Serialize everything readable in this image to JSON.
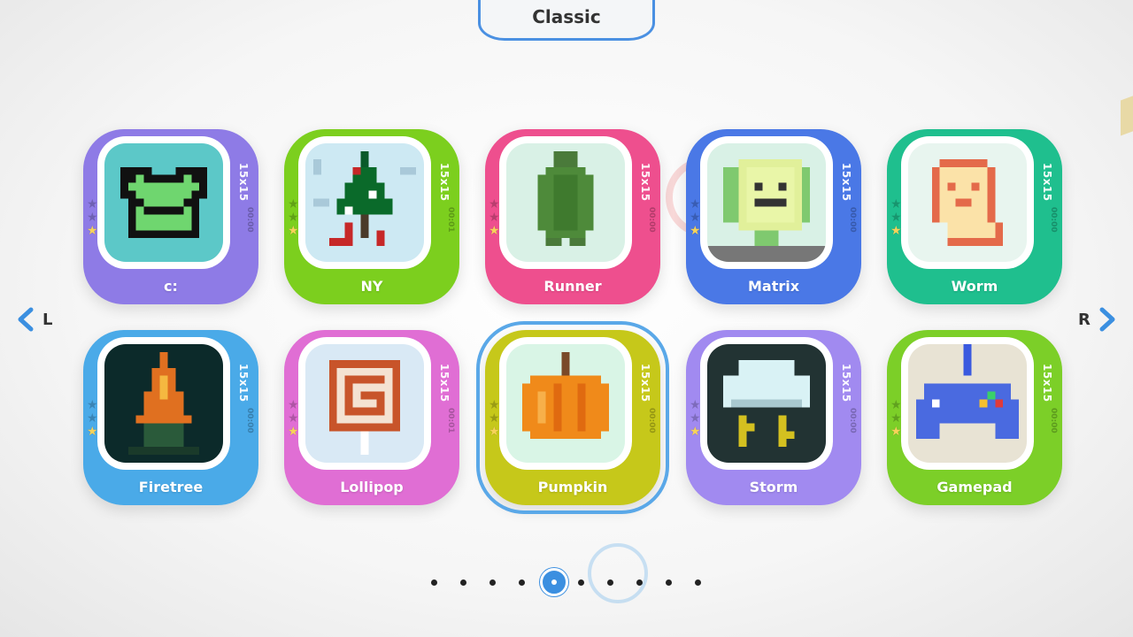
{
  "header": {
    "category": "Classic"
  },
  "nav": {
    "left_label": "L",
    "right_label": "R"
  },
  "puzzles": [
    {
      "title": "c:",
      "size": "15x15",
      "time": "00:00",
      "color": "#8e7be6",
      "stars": 1
    },
    {
      "title": "NY",
      "size": "15x15",
      "time": "00:01",
      "color": "#7ccf1e",
      "stars": 1
    },
    {
      "title": "Runner",
      "size": "15x15",
      "time": "00:00",
      "color": "#ee4f8e",
      "stars": 1
    },
    {
      "title": "Matrix",
      "size": "15x15",
      "time": "00:00",
      "color": "#4a78e6",
      "stars": 1
    },
    {
      "title": "Worm",
      "size": "15x15",
      "time": "00:00",
      "color": "#1fbf8e",
      "stars": 1
    },
    {
      "title": "Firetree",
      "size": "15x15",
      "time": "00:00",
      "color": "#4aaae8",
      "stars": 1
    },
    {
      "title": "Lollipop",
      "size": "15x15",
      "time": "00:01",
      "color": "#e06ed4",
      "stars": 1
    },
    {
      "title": "Pumpkin",
      "size": "15x15",
      "time": "00:00",
      "color": "#c6c81a",
      "stars": 1,
      "selected": true
    },
    {
      "title": "Storm",
      "size": "15x15",
      "time": "00:00",
      "color": "#a18af0",
      "stars": 1
    },
    {
      "title": "Gamepad",
      "size": "15x15",
      "time": "00:00",
      "color": "#7ccf28",
      "stars": 1
    }
  ],
  "pagination": {
    "total": 10,
    "current": 5
  },
  "icons": {
    "left": "chevron-left-icon",
    "right": "chevron-right-icon",
    "star": "star-icon"
  }
}
